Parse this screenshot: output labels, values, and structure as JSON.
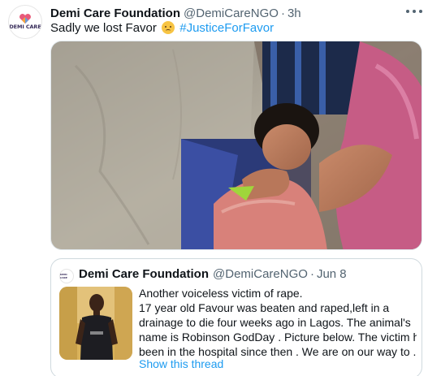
{
  "tweet": {
    "author": {
      "display_name": "Demi Care Foundation",
      "handle": "@DemiCareNGO",
      "avatar_text": "DEMI CARE"
    },
    "separator": "·",
    "time": "3h",
    "text": "Sadly we lost Favor",
    "emoji": "crying-face-emoji",
    "hashtag": "#JusticeForFavor",
    "photo_icon": "photo-image",
    "quote": {
      "display_name": "Demi Care Foundation",
      "handle": "@DemiCareNGO",
      "separator": "·",
      "date": "Jun 8",
      "lines": [
        "Another voiceless victim of rape.",
        "17 year old Favour was beaten and raped,left in a",
        "drainage to die four weeks ago in Lagos. The animal's",
        "name is Robinson GodDay . Picture below. The victim has",
        "been in the hospital since then . We are on our way to ..."
      ],
      "show_thread": "Show this thread"
    }
  },
  "colors": {
    "link": "#1d9bf0",
    "secondary_text": "#536471",
    "border": "#cfd9de"
  }
}
